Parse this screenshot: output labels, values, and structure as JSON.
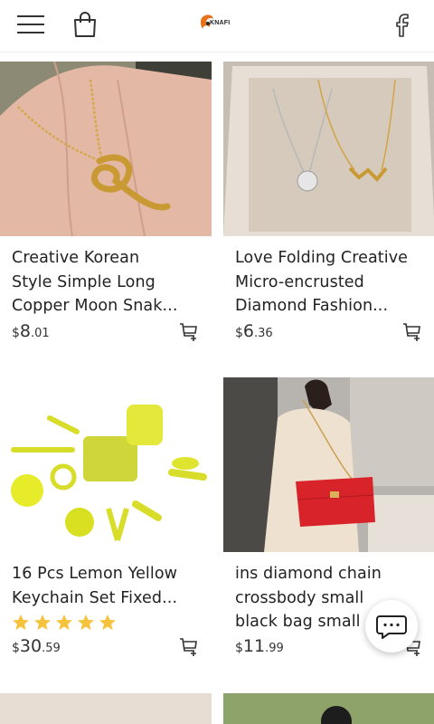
{
  "header": {
    "menu_icon": "hamburger-menu-icon",
    "bag_icon": "shopping-bag-icon",
    "logo_text": "KNAFI",
    "facebook_icon": "facebook-icon"
  },
  "products": [
    {
      "title_lines": [
        "Creative Korean",
        "Style Simple Long",
        "Copper Moon Snak..."
      ],
      "price": {
        "currency": "$",
        "int": "8",
        "dec": ".01"
      },
      "cart_icon": "add-to-cart-icon"
    },
    {
      "title_lines": [
        "Love Folding Creative",
        "Micro-encrusted",
        "Diamond Fashion..."
      ],
      "price": {
        "currency": "$",
        "int": "6",
        "dec": ".36"
      },
      "cart_icon": "add-to-cart-icon"
    },
    {
      "title_lines": [
        "16 Pcs Lemon Yellow",
        "Keychain Set Fixed..."
      ],
      "rating": 5,
      "price": {
        "currency": "$",
        "int": "30",
        "dec": ".59"
      },
      "cart_icon": "add-to-cart-icon"
    },
    {
      "title_lines": [
        "ins diamond chain",
        "crossbody small",
        "black bag small"
      ],
      "price": {
        "currency": "$",
        "int": "11",
        "dec": ".99"
      },
      "cart_icon": "add-to-cart-icon"
    }
  ],
  "chat": {
    "icon": "chat-bubble-icon"
  },
  "colors": {
    "star": "#f7c23c",
    "bag_red": "#d8232a",
    "logo_orange": "#e8711c"
  }
}
